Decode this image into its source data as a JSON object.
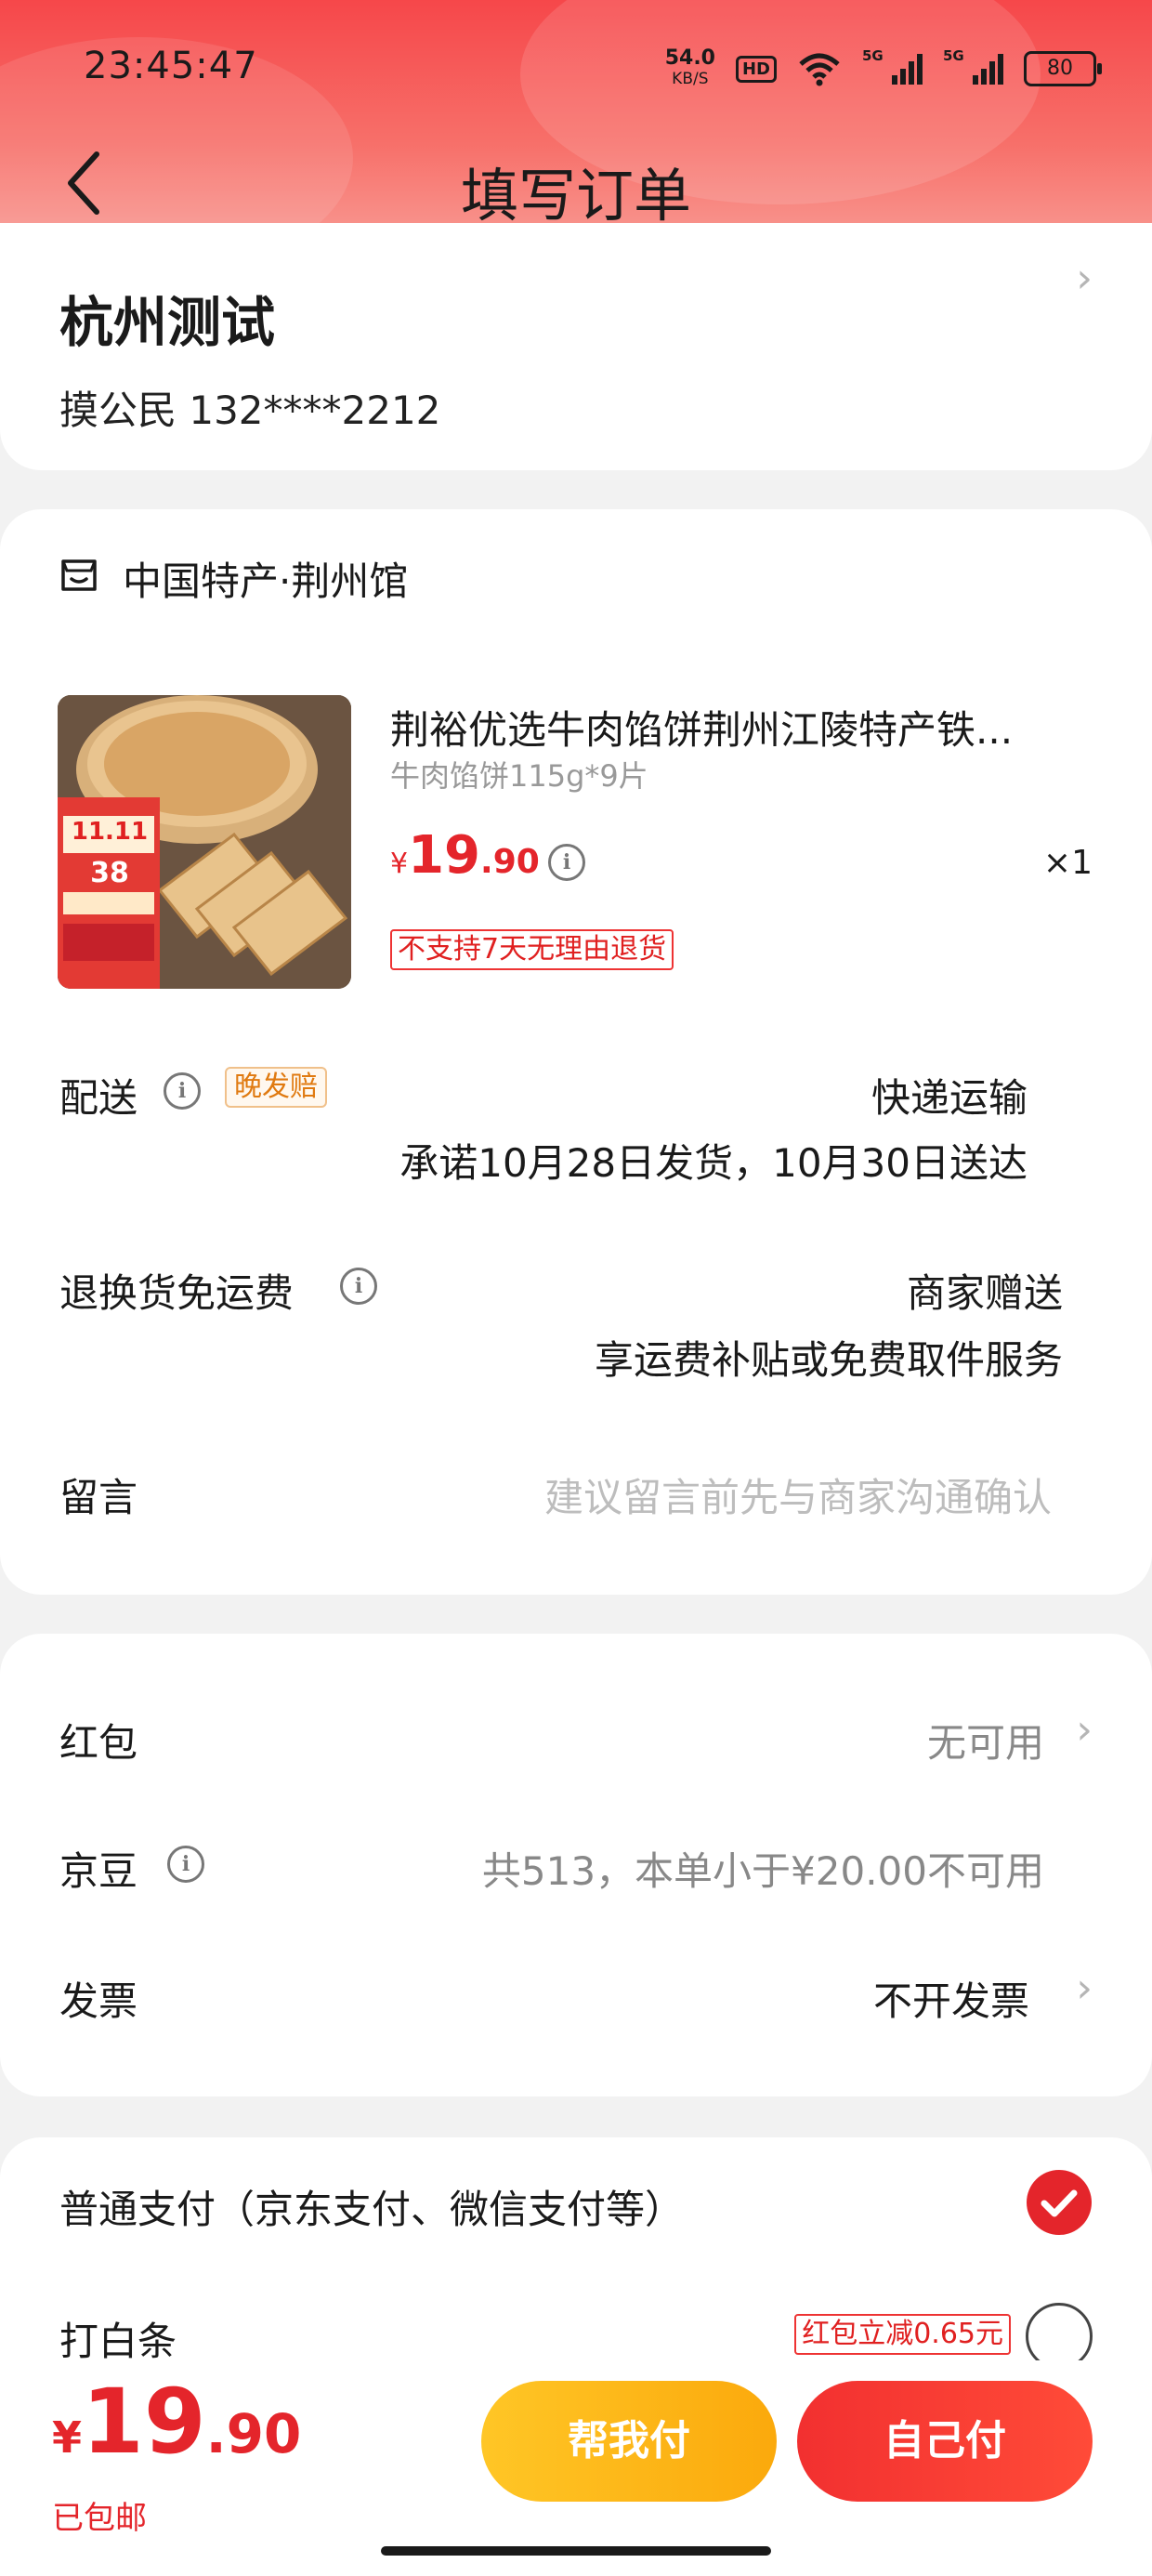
{
  "status_bar": {
    "time": "23:45:47",
    "net_speed": "54.0",
    "net_unit": "KB/S",
    "hd": "HD",
    "signal_1": "5G",
    "signal_2": "5G",
    "battery": "80"
  },
  "header": {
    "title": "填写订单"
  },
  "address": {
    "city": "杭州测试",
    "contact": "摸公民  132****2212"
  },
  "shop": {
    "name": "中国特产·荆州馆"
  },
  "product": {
    "title": "荆裕优选牛肉馅饼荆州江陵特产铁...",
    "spec": "牛肉馅饼115g*9片",
    "price_symbol": "¥",
    "price_int": "19",
    "price_dec": ".90",
    "qty": "×1",
    "return_notice": "不支持7天无理由退货",
    "badge_event": "11.11",
    "badge_price": "38"
  },
  "delivery": {
    "label": "配送",
    "tag": "晚发赔",
    "method": "快递运输",
    "promise": "承诺10月28日发货，10月30日送达"
  },
  "return_shipping": {
    "label": "退换货免运费",
    "value": "商家赠送",
    "desc": "享运费补贴或免费取件服务"
  },
  "message": {
    "label": "留言",
    "placeholder": "建议留言前先与商家沟通确认"
  },
  "benefits": {
    "red_packet": {
      "label": "红包",
      "value": "无可用"
    },
    "jingdou": {
      "label": "京豆",
      "value": "共513，本单小于¥20.00不可用"
    },
    "invoice": {
      "label": "发票",
      "value": "不开发票"
    }
  },
  "payment": {
    "normal": {
      "label": "普通支付（京东支付、微信支付等）",
      "selected": true
    },
    "baitiao": {
      "label": "打白条",
      "promo": "红包立减0.65元",
      "selected": false
    }
  },
  "footer": {
    "price_symbol": "¥",
    "price_int": "19",
    "price_dec": ".90",
    "shipping": "已包邮",
    "help_pay": "帮我付",
    "self_pay": "自己付"
  },
  "colors": {
    "accent": "#e4252b",
    "header_top": "#f6474a",
    "help_pay_btn": "#fdb515",
    "self_pay_btn": "#f23030"
  }
}
